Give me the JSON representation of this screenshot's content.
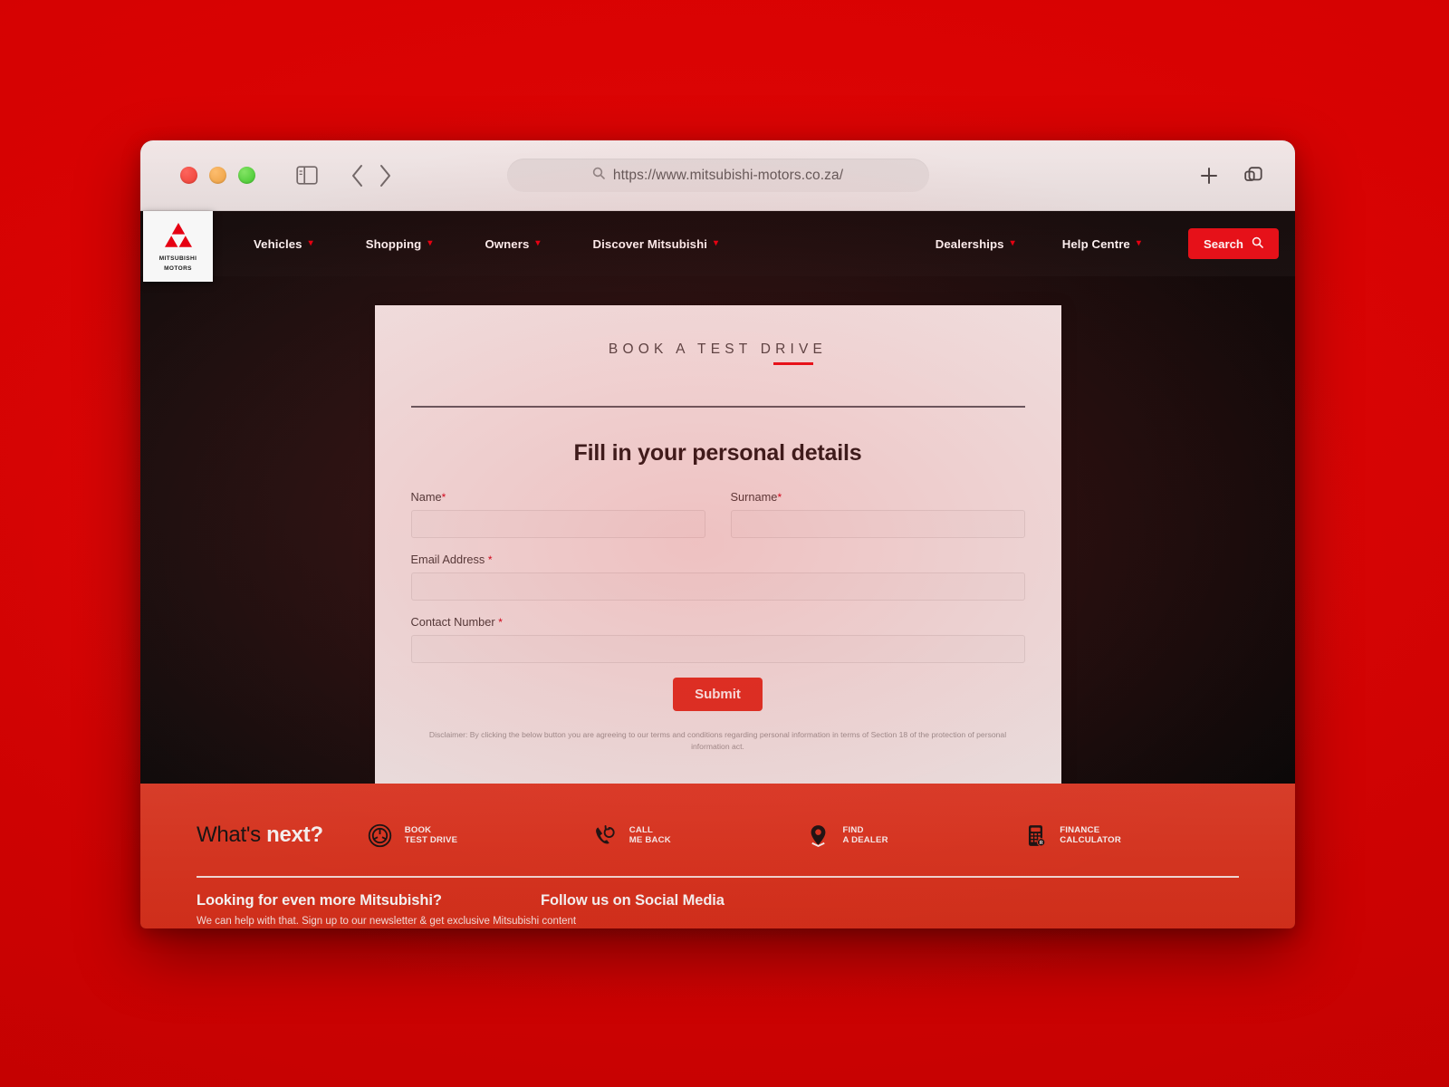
{
  "browser": {
    "url": "https://www.mitsubishi-motors.co.za/",
    "search_icon": "search-icon",
    "sidebar_icon": "sidebar-toggle-icon",
    "back_icon": "chevron-left-icon",
    "forward_icon": "chevron-right-icon",
    "new_tab_icon": "plus-icon",
    "tabs_overview_icon": "copy-tabs-icon"
  },
  "site_nav": {
    "logo": {
      "icon": "mitsubishi-three-diamonds-icon",
      "line1": "MITSUBISHI",
      "line2": "MOTORS"
    },
    "items": [
      {
        "label": "Vehicles",
        "caret": "chevron-down-icon"
      },
      {
        "label": "Shopping",
        "caret": "chevron-down-icon"
      },
      {
        "label": "Owners",
        "caret": "chevron-down-icon"
      },
      {
        "label": "Discover Mitsubishi",
        "caret": "chevron-down-icon"
      }
    ],
    "right_items": [
      {
        "label": "Dealerships",
        "caret": "chevron-down-icon"
      },
      {
        "label": "Help Centre",
        "caret": "chevron-down-icon"
      }
    ],
    "search_button": {
      "label": "Search",
      "icon": "search-icon"
    }
  },
  "form_card": {
    "eyebrow": "BOOK A TEST DRIVE",
    "title": "Fill in your personal details",
    "fields": [
      {
        "label": "Name",
        "required": "*",
        "value": "",
        "placeholder": ""
      },
      {
        "label": "Surname",
        "required": "*",
        "value": "",
        "placeholder": ""
      },
      {
        "label": "Email Address",
        "required": "*",
        "value": "",
        "placeholder": ""
      },
      {
        "label": "Contact Number",
        "required": "*",
        "value": "",
        "placeholder": ""
      }
    ],
    "submit_label": "Submit",
    "disclaimer": "Disclaimer: By clicking the below button you are agreeing to our terms and conditions regarding personal information in terms of Section 18 of the protection of personal information act."
  },
  "footer": {
    "whats_next_light": "What's ",
    "whats_next_bold": "next?",
    "quick_links": [
      {
        "icon": "steering-wheel-icon",
        "line1": "BOOK",
        "line2": "TEST DRIVE"
      },
      {
        "icon": "phone-callback-icon",
        "line1": "CALL",
        "line2": "ME BACK"
      },
      {
        "icon": "map-pin-icon",
        "line1": "FIND",
        "line2": "A DEALER"
      },
      {
        "icon": "calculator-icon",
        "line1": "FINANCE",
        "line2": "CALCULATOR"
      }
    ],
    "newsletter": {
      "heading": "Looking for even more Mitsubishi?",
      "sub": "We can help with that. Sign up to our newsletter & get exclusive Mitsubishi content"
    },
    "social": {
      "heading": "Follow us on Social Media"
    }
  },
  "colors": {
    "brand_red": "#e8121a",
    "accent_red": "#e03326",
    "footer_red": "#dd3823",
    "backdrop_red": "#d60202",
    "nav_dark": "#0e0e0e",
    "card_bg": "#f2f2f2"
  }
}
